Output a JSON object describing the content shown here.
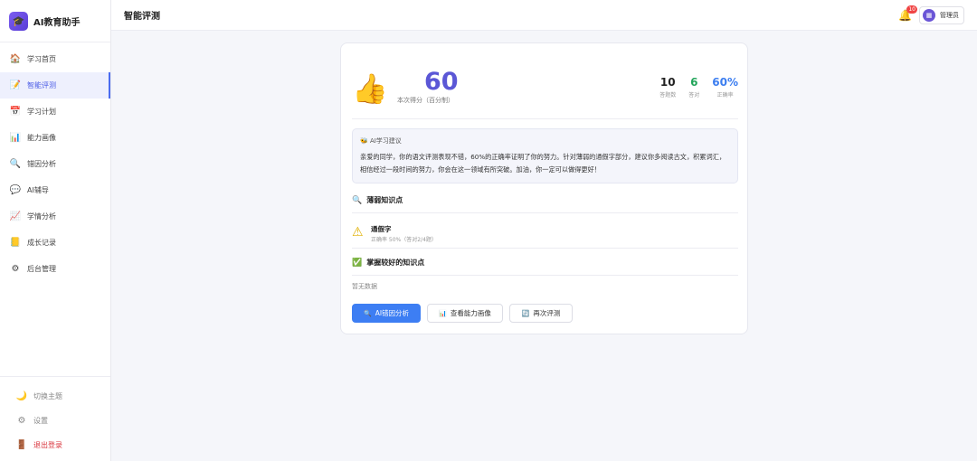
{
  "app": {
    "name": "AI教育助手"
  },
  "sidebar": {
    "items": [
      {
        "label": "学习首页",
        "icon": "home-icon",
        "glyph": "🏠"
      },
      {
        "label": "智能评测",
        "icon": "memo-icon",
        "glyph": "📝",
        "active": true
      },
      {
        "label": "学习计划",
        "icon": "calendar-icon",
        "glyph": "📅"
      },
      {
        "label": "能力画像",
        "icon": "bar-chart-icon",
        "glyph": "📊"
      },
      {
        "label": "错因分析",
        "icon": "magnifier-icon",
        "glyph": "🔍"
      },
      {
        "label": "AI辅导",
        "icon": "chat-bubble-icon",
        "glyph": "💬"
      },
      {
        "label": "学情分析",
        "icon": "trend-chart-icon",
        "glyph": "📈"
      },
      {
        "label": "成长记录",
        "icon": "notebook-icon",
        "glyph": "📒"
      },
      {
        "label": "后台管理",
        "icon": "gear-icon",
        "glyph": "⚙"
      }
    ],
    "bottom": [
      {
        "label": "切换主题",
        "icon": "moon-icon",
        "glyph": "🌙"
      },
      {
        "label": "设置",
        "icon": "settings-icon",
        "glyph": "⚙"
      },
      {
        "label": "退出登录",
        "icon": "door-icon",
        "glyph": "🚪"
      }
    ]
  },
  "header": {
    "title": "智能评测",
    "notification_count": "10",
    "user_name": "管理员"
  },
  "result": {
    "score": "60",
    "score_label": "本次得分（百分制）",
    "stats": [
      {
        "value": "10",
        "label": "答题数",
        "color": "#222222"
      },
      {
        "value": "6",
        "label": "答对",
        "color": "#22a55a"
      },
      {
        "value": "60%",
        "label": "正确率",
        "color": "#3c7ef0"
      }
    ],
    "advice_title": "AI学习建议",
    "advice_text": "亲爱的同学，你的语文评测表现不错，60%的正确率证明了你的努力。针对薄弱的通假字部分，建议你多阅读古文，积累词汇，相信经过一段时间的努力，你会在这一领域有所突破。加油，你一定可以做得更好！",
    "weak_title": "薄弱知识点",
    "weak_items": [
      {
        "name": "通假字",
        "meta": "正确率 50%（答对2/4题）"
      }
    ],
    "strong_title": "掌握较好的知识点",
    "strong_empty": "暂无数据",
    "buttons": {
      "ai_analysis": "AI错因分析",
      "view_profile": "查看能力画像",
      "retest": "再次评测"
    }
  }
}
